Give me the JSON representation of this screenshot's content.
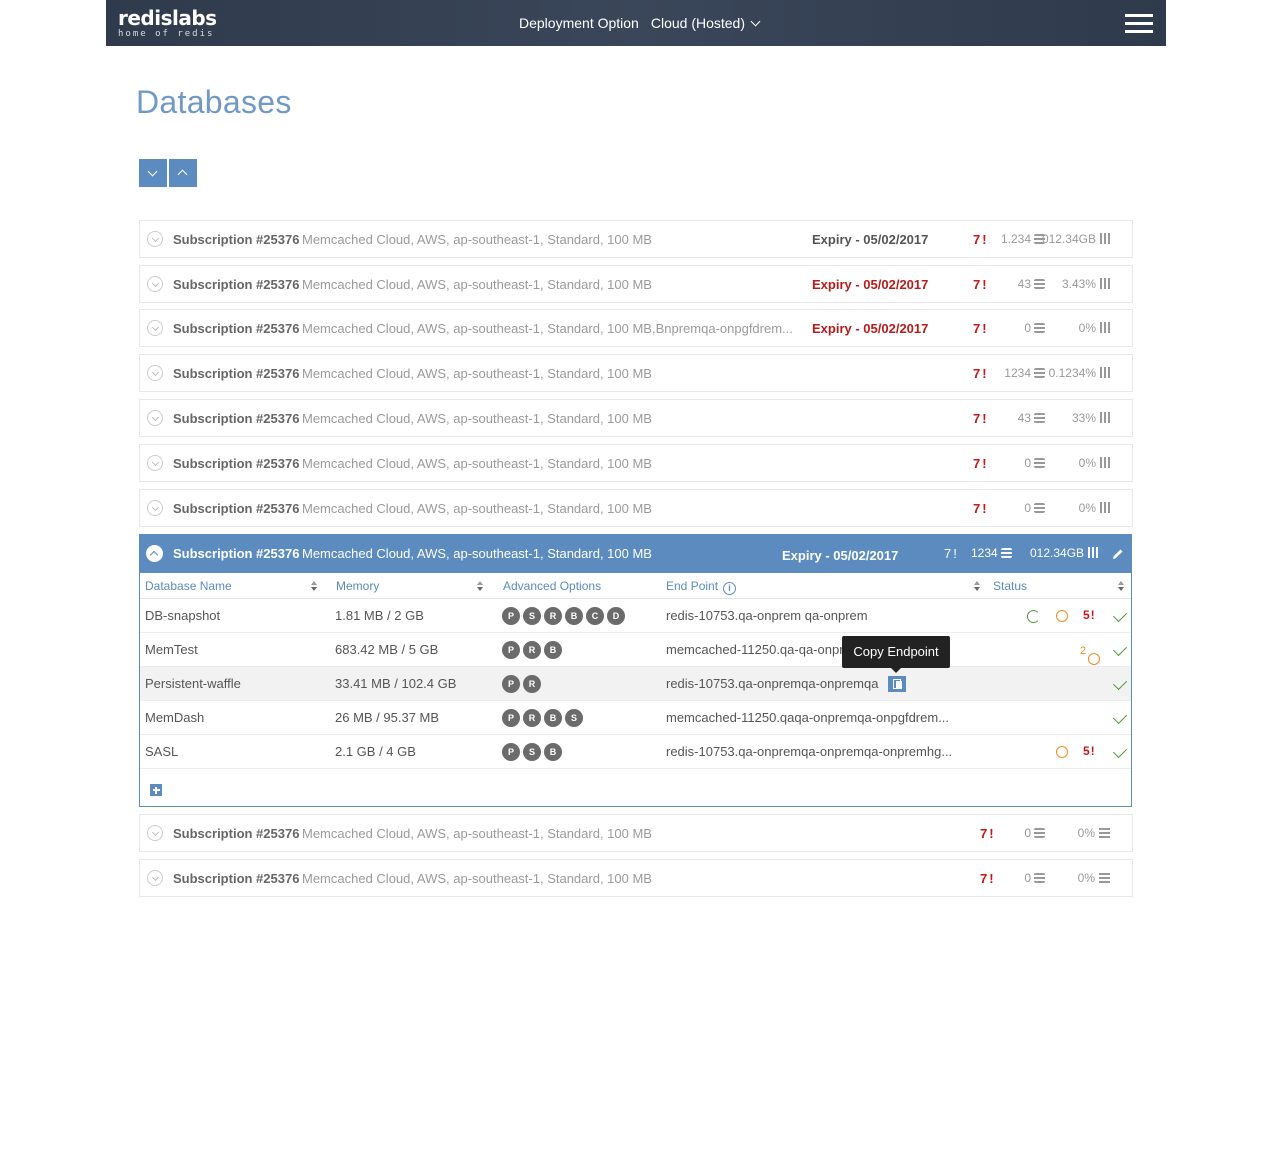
{
  "header": {
    "logo_main": "redislabs",
    "logo_sub": "home of redis",
    "deployment_label": "Deployment Option",
    "deployment_value": "Cloud (Hosted)"
  },
  "page_title": "Databases",
  "subscriptions_top": [
    {
      "name": "Subscription #25376",
      "desc": "Memcached Cloud, AWS, ap-southeast-1, Standard, 100 MB",
      "expiry": "Expiry - 05/02/2017",
      "expiry_red": false,
      "alerts": "7!",
      "count": "1.234",
      "usage": "012.34GB",
      "usage_icon": "bars"
    },
    {
      "name": "Subscription #25376",
      "desc": "Memcached Cloud, AWS, ap-southeast-1, Standard, 100 MB",
      "expiry": "Expiry - 05/02/2017",
      "expiry_red": true,
      "alerts": "7!",
      "count": "43",
      "usage": "3.43%",
      "usage_icon": "bars"
    },
    {
      "name": "Subscription #25376",
      "desc": "Memcached Cloud, AWS, ap-southeast-1, Standard, 100 MB,Bnpremqa-onpgfdrem...",
      "expiry": "Expiry - 05/02/2017",
      "expiry_red": true,
      "alerts": "7!",
      "count": "0",
      "usage": "0%",
      "usage_icon": "bars"
    },
    {
      "name": "Subscription #25376",
      "desc": "Memcached Cloud, AWS, ap-southeast-1, Standard, 100 MB",
      "expiry": "",
      "expiry_red": false,
      "alerts": "7!",
      "count": "1234",
      "usage": "0.1234%",
      "usage_icon": "bars"
    },
    {
      "name": "Subscription #25376",
      "desc": "Memcached Cloud, AWS, ap-southeast-1, Standard, 100 MB",
      "expiry": "",
      "expiry_red": false,
      "alerts": "7!",
      "count": "43",
      "usage": "33%",
      "usage_icon": "bars"
    },
    {
      "name": "Subscription #25376",
      "desc": "Memcached Cloud, AWS, ap-southeast-1, Standard, 100 MB",
      "expiry": "",
      "expiry_red": false,
      "alerts": "7!",
      "count": "0",
      "usage": "0%",
      "usage_icon": "bars"
    },
    {
      "name": "Subscription #25376",
      "desc": "Memcached Cloud, AWS, ap-southeast-1, Standard, 100 MB",
      "expiry": "",
      "expiry_red": false,
      "alerts": "7!",
      "count": "0",
      "usage": "0%",
      "usage_icon": "bars"
    }
  ],
  "expanded": {
    "name": "Subscription #25376",
    "desc": "Memcached Cloud, AWS, ap-southeast-1, Standard, 100 MB",
    "expiry": "Expiry - 05/02/2017",
    "alerts": "7!",
    "count": "1234",
    "usage": "012.34GB",
    "columns": {
      "name": "Database Name",
      "memory": "Memory",
      "options": "Advanced Options",
      "endpoint": "End Point",
      "info": "i",
      "status": "Status"
    },
    "rows": [
      {
        "name": "DB-snapshot",
        "memory": "1.81 MB / 2 GB",
        "options": [
          "P",
          "S",
          "R",
          "B",
          "C",
          "D"
        ],
        "endpoint": "redis-10753.qa-onprem qa-onprem",
        "status": [
          "sync",
          "ring",
          "alert",
          "ok"
        ],
        "alert_text": "5!",
        "count_text": ""
      },
      {
        "name": "MemTest",
        "memory": "683.42 MB / 5 GB",
        "options": [
          "P",
          "R",
          "B"
        ],
        "endpoint": "memcached-11250.qa-qa-onpr",
        "status": [
          "count",
          "ok"
        ],
        "alert_text": "",
        "count_text": "2"
      },
      {
        "name": "Persistent-waffle",
        "memory": "33.41 MB / 102.4 GB",
        "options": [
          "P",
          "R"
        ],
        "endpoint": "redis-10753.qa-onpremqa-onpremqa",
        "status": [
          "ok"
        ],
        "alert_text": "",
        "count_text": ""
      },
      {
        "name": "MemDash",
        "memory": "26 MB / 95.37 MB",
        "options": [
          "P",
          "R",
          "B",
          "S"
        ],
        "endpoint": "memcached-11250.qaqa-onpremqa-onpgfdrem...",
        "status": [
          "ok"
        ],
        "alert_text": "",
        "count_text": ""
      },
      {
        "name": "SASL",
        "memory": "2.1 GB / 4 GB",
        "options": [
          "P",
          "S",
          "B"
        ],
        "endpoint": "redis-10753.qa-onpremqa-onpremqa-onpremhg...",
        "status": [
          "ring",
          "alert",
          "ok"
        ],
        "alert_text": "5!",
        "count_text": ""
      }
    ]
  },
  "tooltip": "Copy Endpoint",
  "subscriptions_bottom": [
    {
      "name": "Subscription #25376",
      "desc": "Memcached Cloud, AWS, ap-southeast-1, Standard, 100 MB",
      "expiry": "",
      "expiry_red": false,
      "alerts": "7!",
      "count": "0",
      "usage": "0%",
      "usage_icon": "lines"
    },
    {
      "name": "Subscription #25376",
      "desc": "Memcached Cloud, AWS, ap-southeast-1, Standard, 100 MB",
      "expiry": "",
      "expiry_red": false,
      "alerts": "7!",
      "count": "0",
      "usage": "0%",
      "usage_icon": "lines"
    }
  ],
  "colors": {
    "header_bg": "#2f3b4c",
    "accent": "#5b8bbf",
    "title": "#7199c6",
    "alert": "#c4171c",
    "ok": "#4f9a3a",
    "warning": "#f08a24"
  }
}
